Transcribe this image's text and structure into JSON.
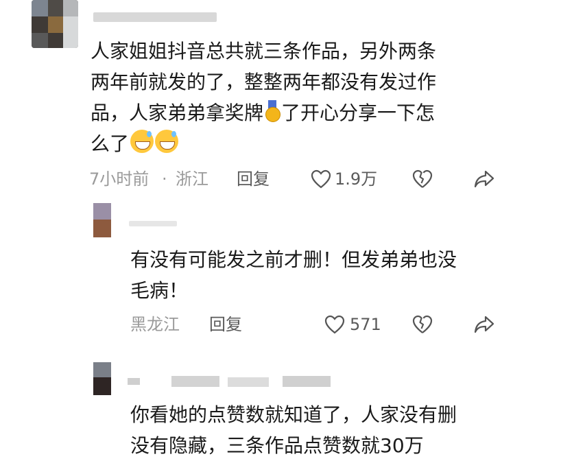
{
  "comments": [
    {
      "lines": [
        "人家姐姐抖音总共就三条作品，另外两条",
        "两年前就发的了，整整两年都没有发过作",
        "品，人家弟弟拿奖牌",
        "了开心分享一下怎",
        "么了"
      ],
      "time": "7小时前",
      "separator": "·",
      "location": "浙江",
      "reply": "回复",
      "likes": "1.9万"
    },
    {
      "lines": [
        "有没有可能发之前才删！但发弟弟也没",
        "毛病！"
      ],
      "location": "黑龙江",
      "reply": "回复",
      "likes": "571"
    },
    {
      "lines": [
        "你看她的点赞数就知道了，人家没有删",
        "没有隐藏，三条作品点赞数就30万"
      ]
    }
  ],
  "icons": {
    "heart": "heart-icon",
    "broken_heart": "dislike-icon",
    "share": "share-icon",
    "medal": "gold-medal-emoji",
    "grin": "grinning-sweat-emoji"
  }
}
